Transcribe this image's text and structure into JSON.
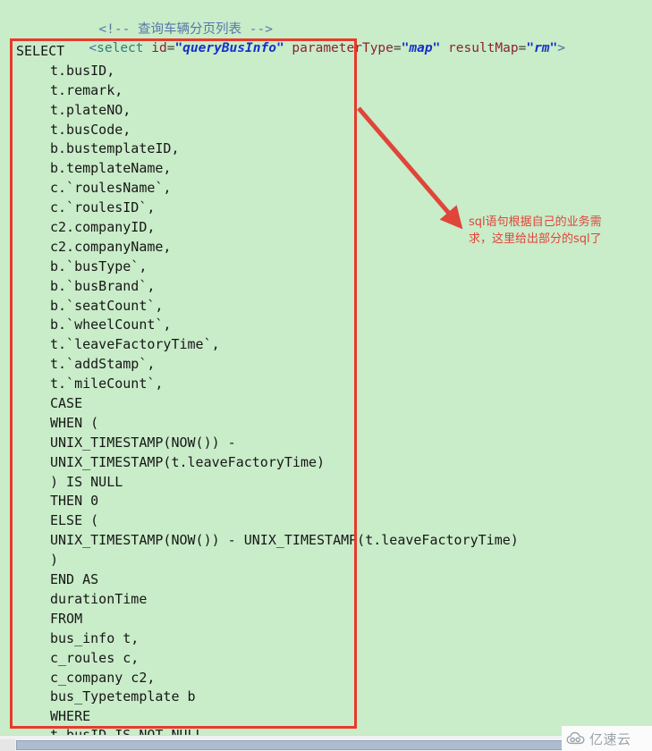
{
  "editor": {
    "background_color": "#c9ecc9",
    "header_lines": [
      {
        "id": "comment-line",
        "parts": [
          {
            "type": "comment",
            "text": "<!-- 查询车辆分页列表 -->"
          }
        ]
      },
      {
        "id": "select-tag-line",
        "parts": [
          {
            "type": "punct",
            "text": "<"
          },
          {
            "type": "tag",
            "text": "select"
          },
          {
            "type": "plain",
            "text": " "
          },
          {
            "type": "attr",
            "text": "id"
          },
          {
            "type": "eq",
            "text": "="
          },
          {
            "type": "value",
            "text": "\"queryBusInfo\""
          },
          {
            "type": "plain",
            "text": " "
          },
          {
            "type": "attr",
            "text": "parameterType"
          },
          {
            "type": "eq",
            "text": "="
          },
          {
            "type": "value",
            "text": "\"map\""
          },
          {
            "type": "plain",
            "text": " "
          },
          {
            "type": "attr",
            "text": "resultMap"
          },
          {
            "type": "eq",
            "text": "="
          },
          {
            "type": "value",
            "text": "\"rm\""
          },
          {
            "type": "punct",
            "text": ">"
          }
        ]
      }
    ],
    "sql_lines": [
      {
        "indent": 0,
        "text": "SELECT"
      },
      {
        "indent": 1,
        "text": "t.busID,"
      },
      {
        "indent": 1,
        "text": "t.remark,"
      },
      {
        "indent": 1,
        "text": "t.plateNO,"
      },
      {
        "indent": 1,
        "text": "t.busCode,"
      },
      {
        "indent": 1,
        "text": "b.bustemplateID,"
      },
      {
        "indent": 1,
        "text": "b.templateName,"
      },
      {
        "indent": 1,
        "text": "c.`roulesName`,"
      },
      {
        "indent": 1,
        "text": "c.`roulesID`,"
      },
      {
        "indent": 1,
        "text": "c2.companyID,"
      },
      {
        "indent": 1,
        "text": "c2.companyName,"
      },
      {
        "indent": 1,
        "text": "b.`busType`,"
      },
      {
        "indent": 1,
        "text": "b.`busBrand`,"
      },
      {
        "indent": 1,
        "text": "b.`seatCount`,"
      },
      {
        "indent": 1,
        "text": "b.`wheelCount`,"
      },
      {
        "indent": 1,
        "text": "t.`leaveFactoryTime`,"
      },
      {
        "indent": 1,
        "text": "t.`addStamp`,"
      },
      {
        "indent": 1,
        "text": "t.`mileCount`,"
      },
      {
        "indent": 1,
        "text": "CASE"
      },
      {
        "indent": 1,
        "text": "WHEN ("
      },
      {
        "indent": 1,
        "text": "UNIX_TIMESTAMP(NOW()) -"
      },
      {
        "indent": 1,
        "text": "UNIX_TIMESTAMP(t.leaveFactoryTime)"
      },
      {
        "indent": 1,
        "text": ") IS NULL"
      },
      {
        "indent": 1,
        "text": "THEN 0"
      },
      {
        "indent": 1,
        "text": "ELSE ("
      },
      {
        "indent": 1,
        "text": "UNIX_TIMESTAMP(NOW()) - UNIX_TIMESTAMP(t.leaveFactoryTime)"
      },
      {
        "indent": 1,
        "text": ")"
      },
      {
        "indent": 1,
        "text": "END AS"
      },
      {
        "indent": 1,
        "text": "durationTime"
      },
      {
        "indent": 1,
        "text": "FROM"
      },
      {
        "indent": 1,
        "text": "bus_info t,"
      },
      {
        "indent": 1,
        "text": "c_roules c,"
      },
      {
        "indent": 1,
        "text": "c_company c2,"
      },
      {
        "indent": 1,
        "text": "bus_Typetemplate b"
      },
      {
        "indent": 1,
        "text": "WHERE"
      }
    ],
    "clipped_line": "t.busID IS NOT NULL"
  },
  "annotation": {
    "box_color": "#e8392c",
    "arrow_color": "#e0453a",
    "note_color": "#e0453a",
    "note_text": "sql语句根据自己的业务需\n求，这里给出部分的sql了"
  },
  "scrollbar": {
    "orientation": "horizontal",
    "track_color": "#f1f1f1",
    "thumb_color": "#adbcd0"
  },
  "watermark": {
    "text": "亿速云",
    "icon": "cloud-icon",
    "color": "#9aa3ab"
  }
}
